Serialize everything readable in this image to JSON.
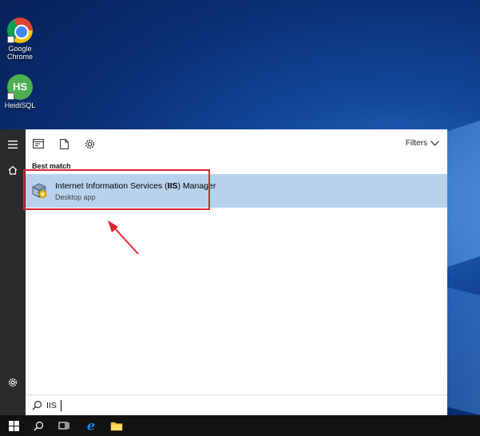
{
  "desktop": {
    "icons": [
      {
        "name": "chrome",
        "label_line1": "Google",
        "label_line2": "Chrome"
      },
      {
        "name": "heidisql",
        "logo_text": "HS",
        "label": "HeidiSQL"
      }
    ]
  },
  "start_menu": {
    "rail": {
      "icons": [
        "hamburger-icon",
        "home-icon",
        "settings-icon"
      ]
    },
    "toolbar": {
      "icons": [
        "apps-icon",
        "documents-icon",
        "settings-icon"
      ],
      "filters_label": "Filters"
    },
    "section_heading": "Best match",
    "best_match": {
      "title_before": "Internet Information Services (",
      "title_bold": "IIS",
      "title_after": ") Manager",
      "subtitle": "Desktop app"
    }
  },
  "search": {
    "query": "IIS"
  },
  "taskbar": {
    "items": [
      "start-icon",
      "search-icon",
      "task-view-icon",
      "edge-icon",
      "file-explorer-icon"
    ]
  },
  "annotation": {
    "highlight_color": "#e0252d"
  }
}
